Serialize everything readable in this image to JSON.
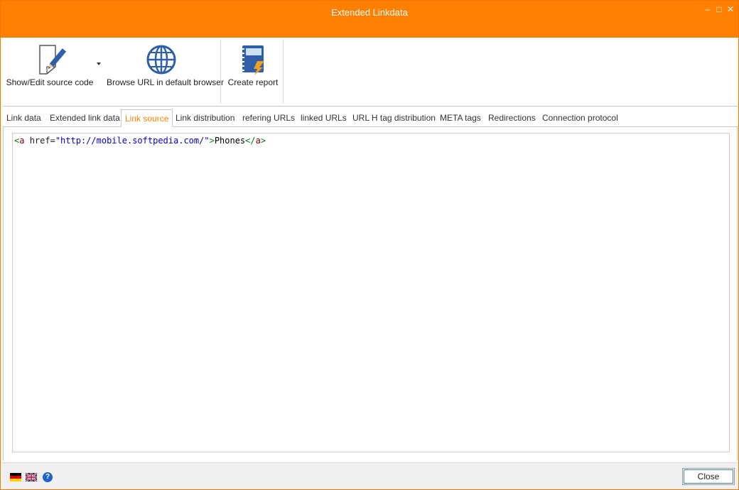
{
  "window": {
    "title": "Extended Linkdata",
    "controls": {
      "minimize": "‒",
      "maximize": "□",
      "close": "✕"
    },
    "accent_color": "#ff8000"
  },
  "ribbon": {
    "buttons": [
      {
        "label": "Show/Edit source code",
        "icon": "edit-document-icon",
        "has_dropdown": true
      },
      {
        "label": "Browse URL in default browser",
        "icon": "globe-icon"
      },
      {
        "label": "Create report",
        "icon": "report-notebook-icon"
      }
    ]
  },
  "tabs": [
    {
      "label": "Link data"
    },
    {
      "label": "Extended link data"
    },
    {
      "label": "Link source",
      "active": true
    },
    {
      "label": "Link distribution"
    },
    {
      "label": "refering URLs"
    },
    {
      "label": "linked URLs"
    },
    {
      "label": "URL H tag distribution"
    },
    {
      "label": "META tags"
    },
    {
      "label": "Redirections"
    },
    {
      "label": "Connection protocol"
    }
  ],
  "source": {
    "open_bracket": "<",
    "tag": "a",
    "attr": " href=",
    "value": "\"http://mobile.softpedia.com/\"",
    "close_bracket": ">",
    "text": "Phones",
    "end_open": "</",
    "end_tag": "a",
    "end_close": ">"
  },
  "statusbar": {
    "languages": [
      "german-flag-icon",
      "uk-flag-icon"
    ],
    "help": "?",
    "close_label": "Close"
  }
}
